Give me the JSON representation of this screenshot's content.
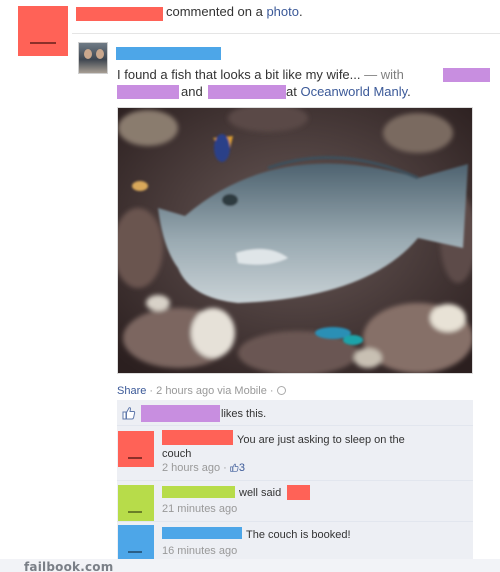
{
  "story": {
    "action_text": "commented on a ",
    "object_link": "photo",
    "object_suffix": "."
  },
  "post": {
    "text": "I found a fish that looks a bit like my wife...",
    "with_text": " — with",
    "and_text": "and",
    "at_text": "at",
    "location": "Oceanworld Manly",
    "location_suffix": "."
  },
  "meta": {
    "share_label": "Share",
    "separator1": " · ",
    "time_text": "2 hours ago via Mobile",
    "separator2": " · "
  },
  "likes": {
    "text": "likes this."
  },
  "comments": [
    {
      "text": "You are just asking to sleep on the",
      "text_cont": "couch",
      "time": "2 hours ago",
      "sep": " · ",
      "like_count": "3"
    },
    {
      "text": "well said",
      "time": "21 minutes ago"
    },
    {
      "text": "The couch is booked!",
      "time": "16 minutes ago"
    }
  ],
  "watermark": "failbook.com",
  "colors": {
    "redact_red": "#ff6257",
    "redact_blue": "#4da6e8",
    "redact_purple": "#c88ee0",
    "redact_green": "#b7dc4a",
    "link": "#3b5998",
    "ufi_bg": "#edeff4"
  }
}
